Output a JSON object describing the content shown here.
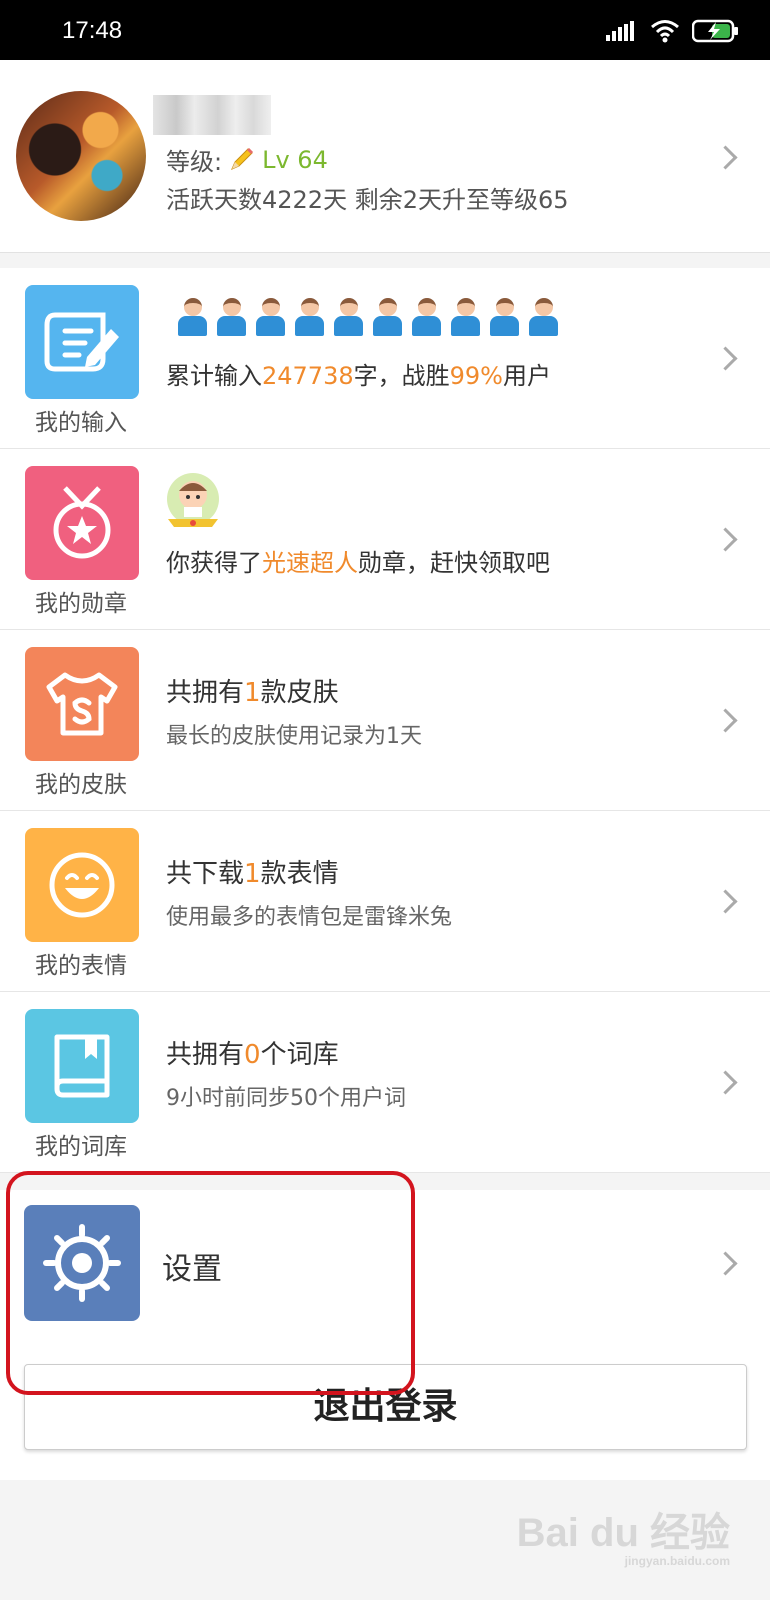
{
  "status_bar": {
    "time": "17:48"
  },
  "profile": {
    "level_label": "等级:",
    "level_value": "Lv 64",
    "active_days": "活跃天数4222天 剩余2天升至等级65"
  },
  "menu": [
    {
      "caption": "我的输入",
      "title_parts": [
        "累计输入",
        "247738",
        "字，战胜",
        "99%",
        "用户"
      ],
      "color": "#55b5ef"
    },
    {
      "caption": "我的勋章",
      "title_parts": [
        "你获得了",
        "光速超人",
        "勋章，赶快领取吧"
      ],
      "color": "#f0607f"
    },
    {
      "caption": "我的皮肤",
      "title_parts": [
        "共拥有",
        "1",
        "款皮肤"
      ],
      "subtitle": "最长的皮肤使用记录为1天",
      "color": "#f3855a"
    },
    {
      "caption": "我的表情",
      "title_parts": [
        "共下载",
        "1",
        "款表情"
      ],
      "subtitle": "使用最多的表情包是雷锋米兔",
      "color": "#ffb347"
    },
    {
      "caption": "我的词库",
      "title_parts": [
        "共拥有",
        "0",
        "个词库"
      ],
      "subtitle": "9小时前同步50个用户词",
      "color": "#5bc6e3"
    }
  ],
  "settings": {
    "label": "设置",
    "color": "#5a7fba"
  },
  "logout": {
    "label": "退出登录"
  },
  "watermark": {
    "main": "Bai du 经验",
    "sub": "jingyan.baidu.com"
  }
}
